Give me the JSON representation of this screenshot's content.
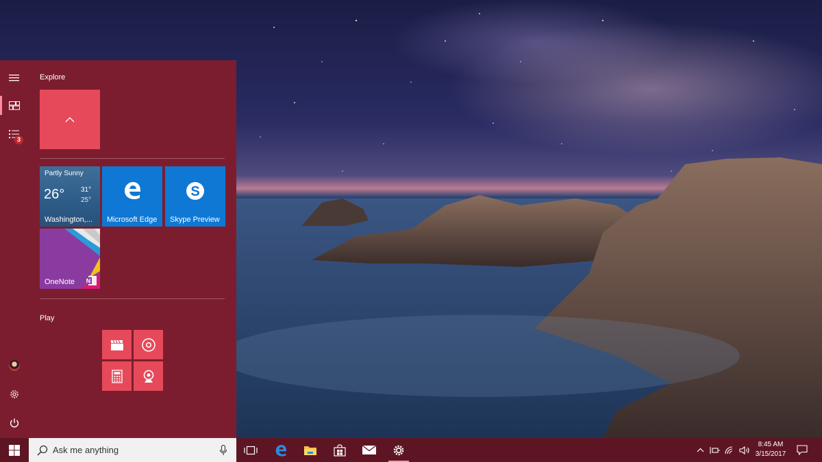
{
  "start_menu": {
    "groups": {
      "explore": "Explore",
      "play": "Play"
    },
    "rail": {
      "notification_count": "3"
    },
    "tiles": {
      "weather": {
        "condition": "Partly Sunny",
        "temp": "26°",
        "high": "31°",
        "low": "25°",
        "location": "Washington,..."
      },
      "edge": {
        "label": "Microsoft Edge"
      },
      "skype": {
        "label": "Skype Preview"
      },
      "onenote": {
        "label": "OneNote"
      }
    }
  },
  "taskbar": {
    "search_placeholder": "Ask me anything",
    "clock": {
      "time": "8:45 AM",
      "date": "3/15/2017"
    }
  },
  "colors": {
    "accent": "#e64a5a",
    "start_bg": "#7c1d2f",
    "taskbar_bg": "#5e1523",
    "tile_blue": "#0f78d4"
  },
  "icons": {
    "start": "windows-logo-icon",
    "search": "magnifier-icon",
    "mic": "microphone-icon",
    "task_view": "task-view-icon",
    "edge": "edge-icon",
    "explorer": "folder-icon",
    "store": "store-icon",
    "mail": "mail-icon",
    "settings": "gear-icon"
  }
}
